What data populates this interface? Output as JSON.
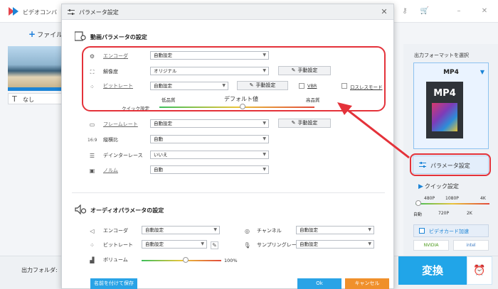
{
  "app": {
    "title": "ビデオコンバ",
    "add_file": "ファイル",
    "subtitle": "なし",
    "output_folder": "出力フォルダ:"
  },
  "right_panel": {
    "format_label": "出力フォーマットを選択",
    "format_name": "MP4",
    "mp4_badge": "MP4",
    "param_button": "パラメータ設定",
    "quick_setting": "クイック設定",
    "ticks_top": [
      "480P",
      "1080P",
      "4K"
    ],
    "ticks_bottom": [
      "自動",
      "720P",
      "2K"
    ],
    "gpu_accel": "ビデオカード加速",
    "vendors": [
      "NVIDIA",
      "intel"
    ],
    "convert": "変換"
  },
  "dialog": {
    "title": "パラメータ設定",
    "video_section": "動画パラメータの設定",
    "video": {
      "encoder_label": "エンコーダ",
      "encoder_value": "自動設定",
      "resolution_label": "解像度",
      "resolution_value": "オリジナル",
      "bitrate_label": "ビットレート",
      "bitrate_value": "自動設定",
      "manual_label": "手動設定",
      "vbr_label": "VBR",
      "lossless_label": "ロスレスモード",
      "quick_label": "クイック設定",
      "low_label": "低品質",
      "default_label": "デフォルト値",
      "high_label": "高品質",
      "framerate_label": "フレームレート",
      "framerate_value": "自動設定",
      "aspect_label": "縦横比",
      "aspect_value": "自動",
      "deinterlace_label": "デインターレース",
      "deinterlace_value": "いいえ",
      "norm_label": "ノルム",
      "norm_value": "自動"
    },
    "audio_section": "オーディオパラメータの設定",
    "audio": {
      "encoder_label": "エンコーダ",
      "encoder_value": "自動設定",
      "bitrate_label": "ビットレート",
      "bitrate_value": "自動設定",
      "channel_label": "チャンネル",
      "channel_value": "自動設定",
      "samplerate_label": "サンプリングレート",
      "samplerate_value": "自動設定",
      "volume_label": "ボリューム",
      "volume_value": "100%",
      "volume_level": 0.55
    },
    "save_as": "名前を付けて保存",
    "ok": "Ok",
    "cancel": "キャンセル"
  },
  "colors": {
    "accent": "#1c84d6",
    "highlight": "#e4323a",
    "ok": "#2aa3e6",
    "cancel": "#f0902b"
  }
}
